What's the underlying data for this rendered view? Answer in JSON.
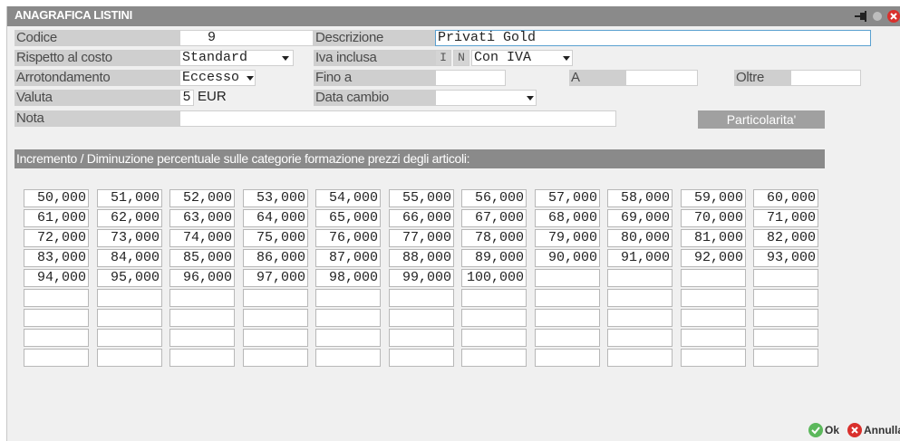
{
  "window": {
    "title": "ANAGRAFICA LISTINI"
  },
  "form": {
    "codice": {
      "label": "Codice",
      "value": "9"
    },
    "descrizione": {
      "label": "Descrizione",
      "value": "Privati Gold"
    },
    "rispetto": {
      "label": "Rispetto al costo",
      "value": "Standard"
    },
    "iva": {
      "label": "Iva inclusa",
      "flag_i": "I",
      "flag_n": "N",
      "value": "Con IVA"
    },
    "arrotondamento": {
      "label": "Arrotondamento",
      "value": "Eccesso"
    },
    "fino_a": {
      "label": "Fino a",
      "value": ""
    },
    "a": {
      "label": "A",
      "value": ""
    },
    "oltre": {
      "label": "Oltre",
      "value": ""
    },
    "valuta": {
      "label": "Valuta",
      "code": "5",
      "currency": "EUR"
    },
    "data_cambio": {
      "label": "Data cambio",
      "value": ""
    },
    "nota": {
      "label": "Nota",
      "value": ""
    },
    "particolarita_button": "Particolarita'"
  },
  "section_title": "Incremento / Diminuzione percentuale sulle categorie formazione prezzi degli articoli:",
  "percentages": [
    [
      "50,000",
      "51,000",
      "52,000",
      "53,000",
      "54,000",
      "55,000",
      "56,000",
      "57,000",
      "58,000",
      "59,000",
      "60,000"
    ],
    [
      "61,000",
      "62,000",
      "63,000",
      "64,000",
      "65,000",
      "66,000",
      "67,000",
      "68,000",
      "69,000",
      "70,000",
      "71,000"
    ],
    [
      "72,000",
      "73,000",
      "74,000",
      "75,000",
      "76,000",
      "77,000",
      "78,000",
      "79,000",
      "80,000",
      "81,000",
      "82,000"
    ],
    [
      "83,000",
      "84,000",
      "85,000",
      "86,000",
      "87,000",
      "88,000",
      "89,000",
      "90,000",
      "91,000",
      "92,000",
      "93,000"
    ],
    [
      "94,000",
      "95,000",
      "96,000",
      "97,000",
      "98,000",
      "99,000",
      "100,000",
      "",
      "",
      "",
      ""
    ],
    [
      "",
      "",
      "",
      "",
      "",
      "",
      "",
      "",
      "",
      "",
      ""
    ],
    [
      "",
      "",
      "",
      "",
      "",
      "",
      "",
      "",
      "",
      "",
      ""
    ],
    [
      "",
      "",
      "",
      "",
      "",
      "",
      "",
      "",
      "",
      "",
      ""
    ],
    [
      "",
      "",
      "",
      "",
      "",
      "",
      "",
      "",
      "",
      "",
      ""
    ]
  ],
  "buttons": {
    "ok": "Ok",
    "annulla": "Annulla"
  },
  "colors": {
    "titlebar": "#8a8a8a",
    "label_bg": "#cfcfcf",
    "ok_green": "#5cb85c",
    "cancel_red": "#d9302c"
  }
}
